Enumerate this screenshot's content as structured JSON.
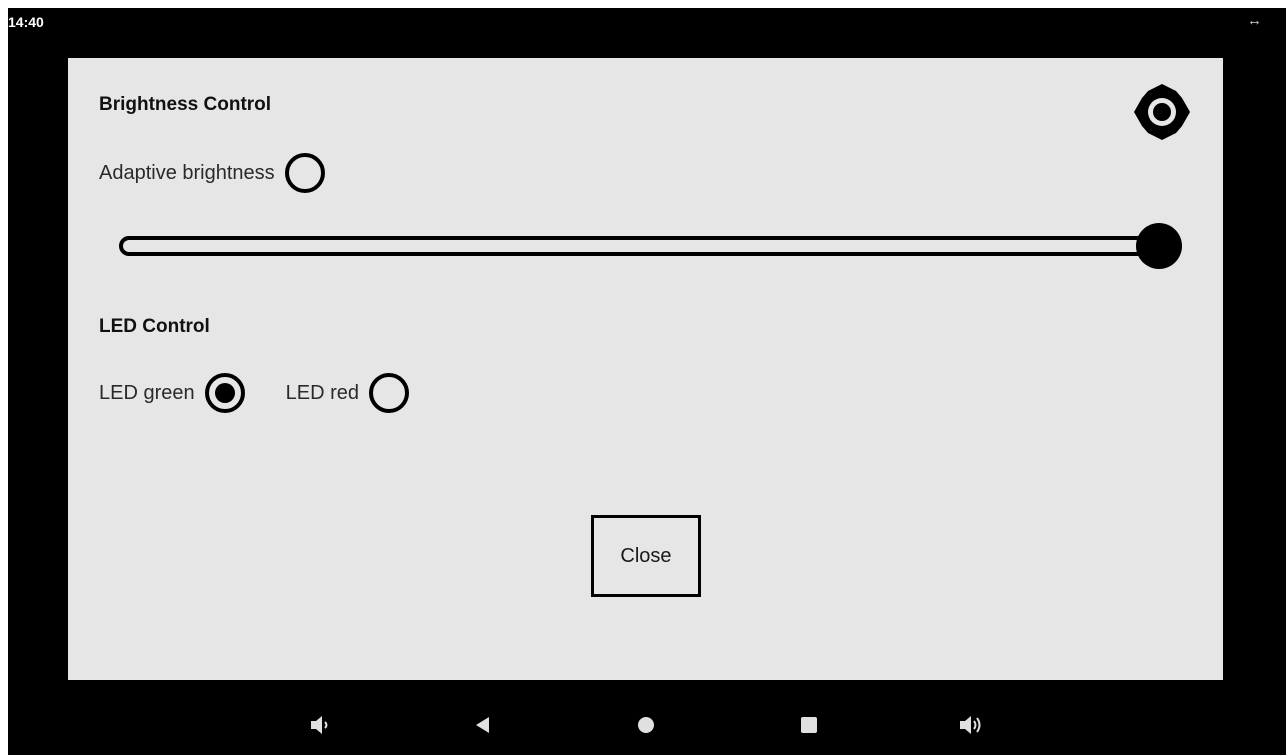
{
  "status_bar": {
    "time": "14:40",
    "resize_glyph": "↔"
  },
  "dialog": {
    "brightness_title": "Brightness Control",
    "adaptive_label": "Adaptive brightness",
    "adaptive_checked": false,
    "brightness_level": 1.0,
    "led_title": "LED Control",
    "led_options": [
      {
        "label": "LED green",
        "selected": true
      },
      {
        "label": "LED red",
        "selected": false
      }
    ],
    "close_label": "Close",
    "header_icon": "brightness-icon"
  },
  "nav_bar": {
    "buttons": [
      "volume-down-icon",
      "back-icon",
      "home-icon",
      "recents-icon",
      "volume-up-icon"
    ]
  },
  "colors": {
    "screen_background": "#000000",
    "dialog_background": "#e6e6e6",
    "foreground": "#000000",
    "nav_icon": "#e0e0e0"
  }
}
